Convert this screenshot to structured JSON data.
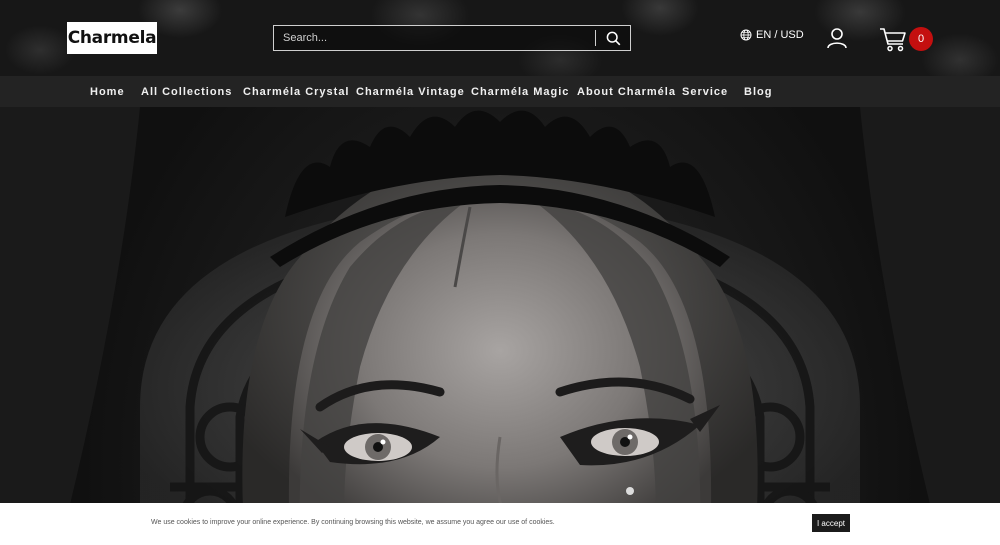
{
  "header": {
    "logo_text": "Charmela",
    "search_placeholder": "Search...",
    "lang_currency": "EN / USD",
    "cart_count": "0",
    "icons": {
      "search": "search-icon",
      "globe": "globe-icon",
      "account": "user-icon",
      "cart": "cart-icon"
    },
    "colors": {
      "badge": "#c40f0f",
      "background": "#171717"
    }
  },
  "nav": {
    "items": [
      {
        "label": "Home"
      },
      {
        "label": "All Collections"
      },
      {
        "label": "Charméla Crystal"
      },
      {
        "label": "Charméla Vintage"
      },
      {
        "label": "Charméla Magic"
      },
      {
        "label": "About Charméla"
      },
      {
        "label": "Service"
      },
      {
        "label": "Blog"
      }
    ],
    "background": "#232323"
  },
  "cookie": {
    "text": "We use cookies to improve your online experience. By continuing browsing this website, we assume you agree our use of cookies.",
    "accept_label": "I accept"
  }
}
